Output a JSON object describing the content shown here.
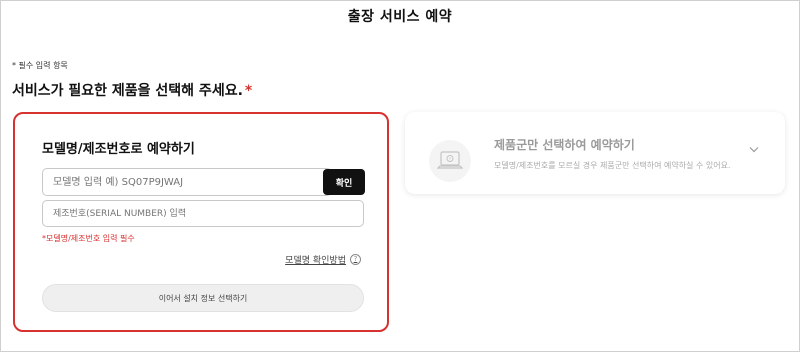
{
  "page": {
    "title": "출장 서비스 예약"
  },
  "form": {
    "required_note": "* 필수 입력 항목",
    "heading": "서비스가 필요한 제품을 선택해 주세요.",
    "heading_star": "*"
  },
  "model_card": {
    "title": "모델명/제조번호로 예약하기",
    "model_input_placeholder": "모델명 입력 예) SQ07P9JWAJ",
    "confirm_label": "확인",
    "serial_input_placeholder": "제조번호(SERIAL NUMBER) 입력",
    "required_message": "*모델명/제조번호 입력 필수",
    "howto_label": "모델명 확인방법",
    "help_glyph": "?",
    "next_label": "이어서 설치 정보 선택하기"
  },
  "category_card": {
    "title": "제품군만 선택하여 예약하기",
    "description": "모델명/제조번호를 모르실 경우 제품군만 선택하여 예약하실 수 있어요.",
    "icon": "laptop-icon",
    "chevron_icon": "chevron-down-icon"
  },
  "colors": {
    "accent_red": "#d6322f",
    "button_dark": "#111111",
    "muted_text": "#9a9a9a"
  }
}
